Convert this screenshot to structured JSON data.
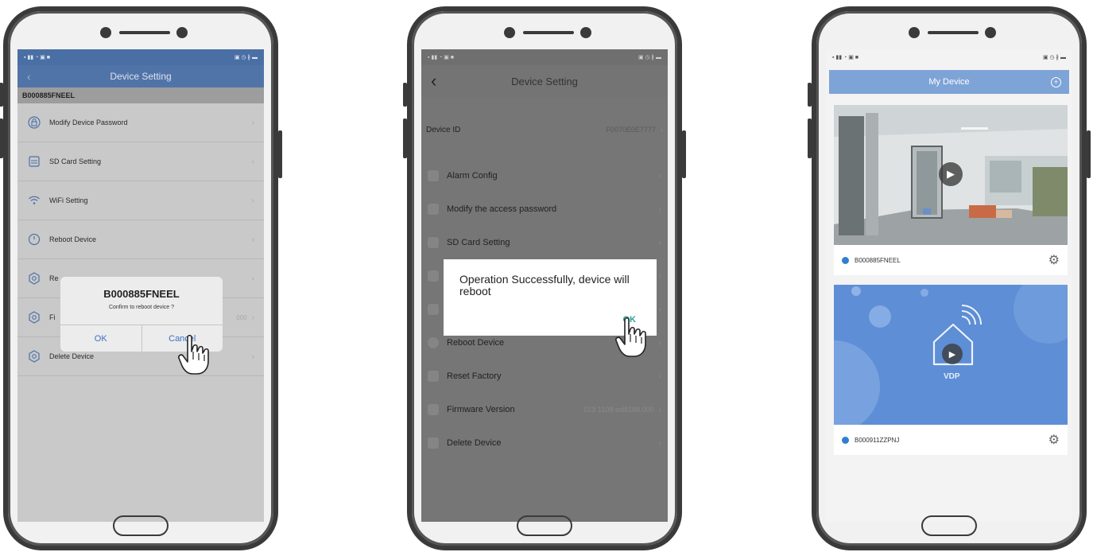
{
  "phone1": {
    "nav_title": "Device Setting",
    "device_name": "B000885FNEEL",
    "menu": [
      {
        "label": "Modify Device Password",
        "icon": "lock-icon"
      },
      {
        "label": "SD Card Setting",
        "icon": "sd-card-icon"
      },
      {
        "label": "WiFi Setting",
        "icon": "wifi-icon"
      },
      {
        "label": "Reboot Device",
        "icon": "power-icon"
      },
      {
        "label": "Re",
        "icon": "gear-icon"
      },
      {
        "label": "Fi",
        "icon": "gear-icon",
        "value": "000"
      },
      {
        "label": "Delete Device",
        "icon": "gear-icon"
      }
    ],
    "dialog": {
      "title": "B000885FNEEL",
      "message": "Confirm to reboot device ?",
      "ok_label": "OK",
      "cancel_label": "Cancel"
    }
  },
  "phone2": {
    "nav_title": "Device Setting",
    "device_id_label": "Device ID",
    "device_id_value": "F0070E0E7777",
    "menu": [
      {
        "label": "Alarm Config"
      },
      {
        "label": "Modify the access password"
      },
      {
        "label": "SD Card Setting"
      },
      {
        "label": ""
      },
      {
        "label": ""
      },
      {
        "label": "Reboot Device"
      },
      {
        "label": "Reset Factory"
      },
      {
        "label": "Firmware Version",
        "value": "019 1108-ssl8188.000"
      },
      {
        "label": "Delete Device"
      }
    ],
    "dialog": {
      "message": "Operation Successfully, device will reboot",
      "ok_label": "OK"
    }
  },
  "phone3": {
    "nav_title": "My Device",
    "devices": [
      {
        "name": "B000885FNEEL"
      },
      {
        "name": "B000911ZZPNJ",
        "logo_text": "VDP"
      }
    ]
  },
  "colors": {
    "accent_blue": "#5174a8",
    "my_device_header": "#7ea3d6",
    "ok_teal": "#2aa197"
  }
}
